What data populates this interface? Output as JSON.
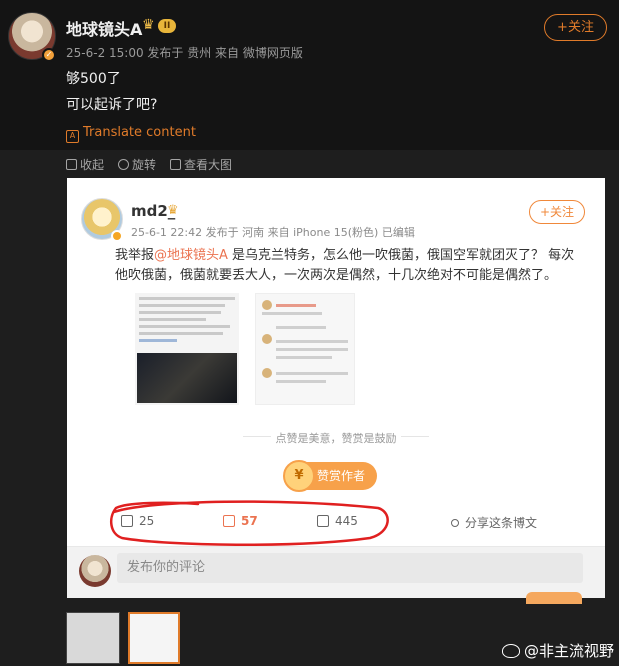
{
  "post": {
    "username": "地球镜头A",
    "level": "II",
    "meta": "25-6-2 15:00  发布于 贵州  来自 微博网页版",
    "follow": "+关注",
    "lines": [
      "够500了",
      "可以起诉了吧?"
    ],
    "translate": "Translate content"
  },
  "viewer_toolbar": [
    "收起",
    "旋转",
    "查看大图"
  ],
  "card": {
    "username": "md2_",
    "meta": "25-6-1 22:42  发布于 河南  来自 iPhone 15(粉色)  已编辑",
    "follow": "+关注",
    "text_before": "我举报",
    "mention": "@地球镜头A",
    "text_after": " 是乌克兰特务，怎么他一吹俄菌，俄国空军就团灭了？ 每次他吹俄菌，俄菌就要丢大人，一次两次是偶然，十几次绝对不可能是偶然了。",
    "reward_hint": "点赞是美意，赞赏是鼓励",
    "reward_button": "赞赏作者",
    "actions": {
      "repost": "25",
      "comment": "57",
      "like": "445",
      "share": "分享这条博文"
    },
    "comment_placeholder": "发布你的评论"
  },
  "watermark": "@非主流视野",
  "colors": {
    "accent": "#e07b2a",
    "mention": "#eb7350",
    "scribble": "#e02020"
  }
}
